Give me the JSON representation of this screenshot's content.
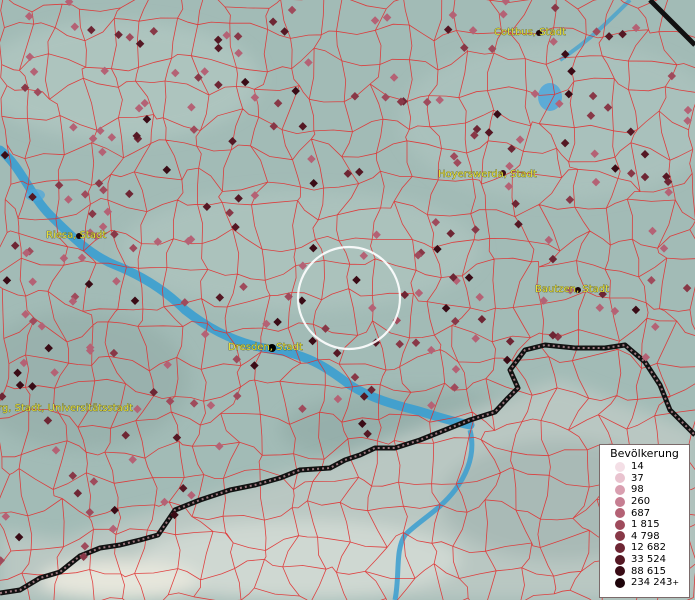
{
  "map": {
    "cities": [
      {
        "name": "Cottbus, Stadt"
      },
      {
        "name": "Hoyerswerda, Stadt"
      },
      {
        "name": "Riesa, Stadt"
      },
      {
        "name": "Bautzen, Stadt"
      },
      {
        "name": "Dresden, Stadt"
      },
      {
        "name": "rg, Stadt, Universitätsstadt"
      }
    ]
  },
  "legend": {
    "title": "Bevölkerung",
    "items": [
      {
        "label": "14",
        "color": "#f4dfe6"
      },
      {
        "label": "37",
        "color": "#e9c3cf"
      },
      {
        "label": "98",
        "color": "#d99fb0"
      },
      {
        "label": "260",
        "color": "#c67e92"
      },
      {
        "label": "687",
        "color": "#b46275"
      },
      {
        "label": "1 815",
        "color": "#9f4b5c"
      },
      {
        "label": "4 798",
        "color": "#883847"
      },
      {
        "label": "12 682",
        "color": "#6e2634"
      },
      {
        "label": "33 524",
        "color": "#551824"
      },
      {
        "label": "88 615",
        "color": "#3a0c16"
      },
      {
        "label": "234 243",
        "color": "#1e040a"
      }
    ],
    "plus_mark": "+"
  },
  "colors": {
    "terrain": "#9fb9b4",
    "boundary": "#e03030",
    "river": "#3a9ed0",
    "border": "#111111",
    "label": "#e8e23a"
  }
}
